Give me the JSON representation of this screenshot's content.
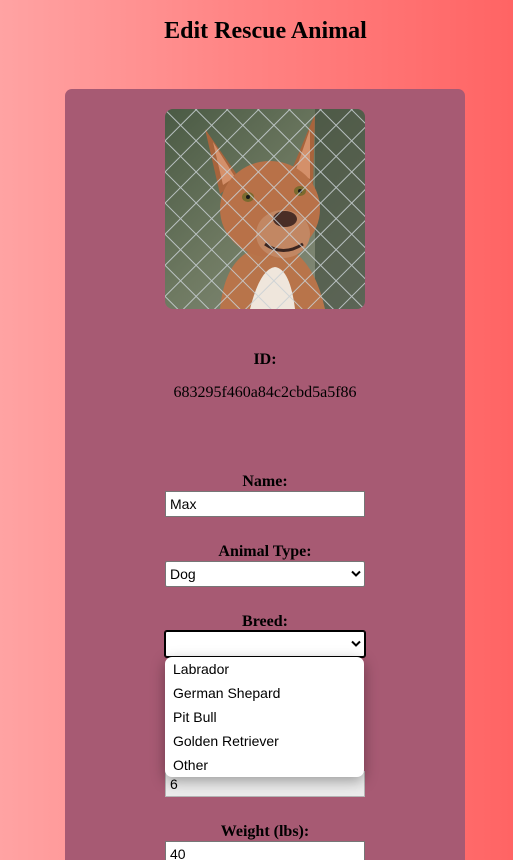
{
  "page": {
    "title": "Edit Rescue Animal"
  },
  "animal": {
    "photo_icon": "dog-photo",
    "id_label": "ID:",
    "id_value": "683295f460a84c2cbd5a5f86",
    "name_label": "Name:",
    "name_value": "Max",
    "type_label": "Animal Type:",
    "type_value": "Dog",
    "breed_label": "Breed:",
    "breed_value": "",
    "breed_options": [
      "Labrador",
      "German Shepard",
      "Pit Bull",
      "Golden Retriever",
      "Other"
    ],
    "age_value": "6",
    "weight_label": "Weight (lbs):",
    "weight_value": "40"
  },
  "colors": {
    "background_left": "#ffa3a3",
    "background_right": "#ff6464",
    "card": "#a75a73"
  }
}
